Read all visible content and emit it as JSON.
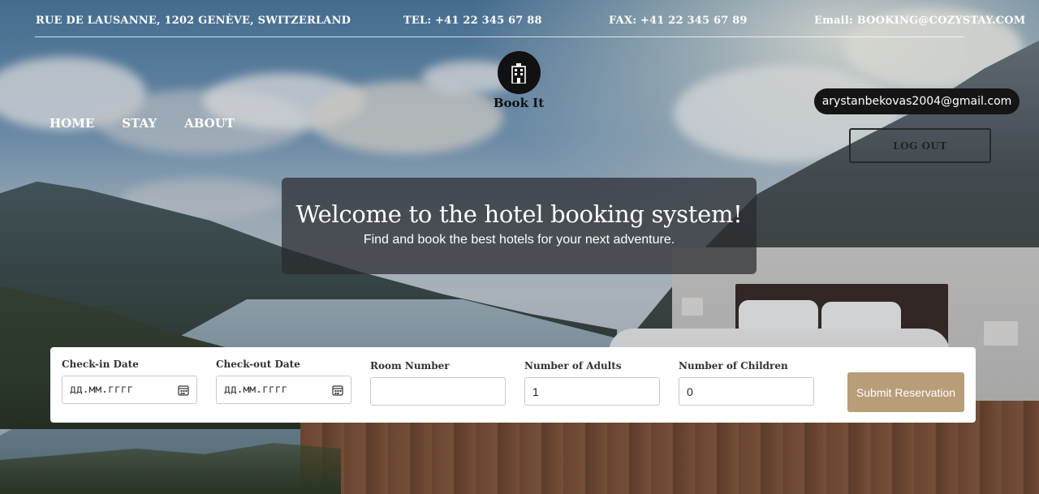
{
  "topbar": {
    "address": "RUE DE LAUSANNE, 1202 GENÈVE, SWITZERLAND",
    "tel": "TEL: +41 22 345 67 88",
    "fax": "FAX: +41 22 345 67 89",
    "email": "Email: BOOKING@COZYSTAY.COM"
  },
  "logo": {
    "text": "Book It",
    "icon": "hotel-building-icon"
  },
  "nav": {
    "items": [
      {
        "label": "HOME"
      },
      {
        "label": "STAY"
      },
      {
        "label": "ABOUT"
      }
    ]
  },
  "user": {
    "email": "arystanbekovas2004@gmail.com",
    "logout_label": "LOG OUT"
  },
  "hero": {
    "title": "Welcome to the hotel booking system!",
    "subtitle": "Find and book the best hotels for your next adventure."
  },
  "form": {
    "checkin": {
      "label": "Check-in Date",
      "placeholder": "дд.мм.гггг",
      "icon": "calendar-icon"
    },
    "checkout": {
      "label": "Check-out Date",
      "placeholder": "дд.мм.гггг",
      "icon": "calendar-icon"
    },
    "room": {
      "label": "Room Number",
      "value": ""
    },
    "adults": {
      "label": "Number of Adults",
      "value": "1"
    },
    "children": {
      "label": "Number of Children",
      "value": "0"
    },
    "submit_label": "Submit Reservation"
  },
  "colors": {
    "accent": "#b79d78",
    "dark": "#151515"
  }
}
